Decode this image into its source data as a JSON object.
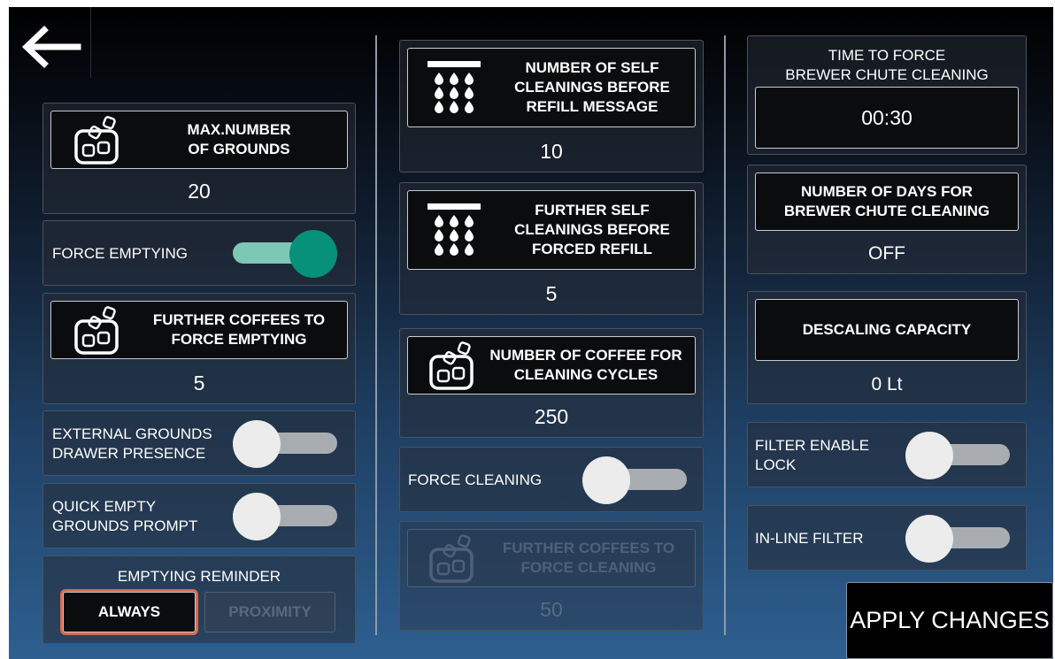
{
  "colors": {
    "toggle_on_knob": "#07907a",
    "toggle_on_track": "#7cc7b5",
    "toggle_off_knob": "#ececec",
    "toggle_off_track": "#a9adb2",
    "selected_outline": "#d86a52",
    "disabled_text": "#566a84"
  },
  "header": {
    "back_icon": "arrow-left-icon"
  },
  "column1": {
    "max_grounds": {
      "label": "MAX.NUMBER\nOF GROUNDS",
      "icon": "grounds-container-icon",
      "value": "20"
    },
    "force_emptying": {
      "label": "FORCE EMPTYING",
      "on": true
    },
    "further_coffees_emptying": {
      "label": "FURTHER COFFEES TO\nFORCE EMPTYING",
      "icon": "grounds-container-icon",
      "value": "5"
    },
    "external_grounds_drawer": {
      "label": "EXTERNAL GROUNDS\nDRAWER PRESENCE",
      "on": false
    },
    "quick_empty": {
      "label": "QUICK EMPTY\nGROUNDS PROMPT",
      "on": false
    },
    "emptying_reminder": {
      "title": "EMPTYING REMINDER",
      "options": [
        "ALWAYS",
        "PROXIMITY"
      ],
      "selected": "ALWAYS"
    }
  },
  "column2": {
    "self_cleanings_refill": {
      "label": "NUMBER OF SELF\nCLEANINGS BEFORE\nREFILL MESSAGE",
      "icon": "shower-drops-icon",
      "value": "10"
    },
    "further_self_cleanings": {
      "label": "FURTHER SELF\nCLEANINGS BEFORE\nFORCED REFILL",
      "icon": "shower-drops-icon",
      "value": "5"
    },
    "coffee_cleaning_cycles": {
      "label": "NUMBER OF COFFEE FOR\nCLEANING CYCLES",
      "icon": "grounds-container-icon",
      "value": "250"
    },
    "force_cleaning": {
      "label": "FORCE CLEANING",
      "on": false
    },
    "further_coffees_cleaning": {
      "label": "FURTHER COFFEES TO\nFORCE CLEANING",
      "icon": "grounds-container-icon",
      "value": "50",
      "disabled": true
    }
  },
  "column3": {
    "time_force_brewer": {
      "title": "TIME TO FORCE\nBREWER CHUTE CLEANING",
      "value": "00:30"
    },
    "days_brewer": {
      "label": "NUMBER OF DAYS FOR\nBREWER CHUTE CLEANING",
      "value": "OFF"
    },
    "descaling": {
      "label": "DESCALING CAPACITY",
      "value": "0 Lt"
    },
    "filter_enable_lock": {
      "label": "FILTER ENABLE\nLOCK",
      "on": false
    },
    "inline_filter": {
      "label": "IN-LINE FILTER",
      "on": false
    }
  },
  "apply_button": "APPLY CHANGES"
}
